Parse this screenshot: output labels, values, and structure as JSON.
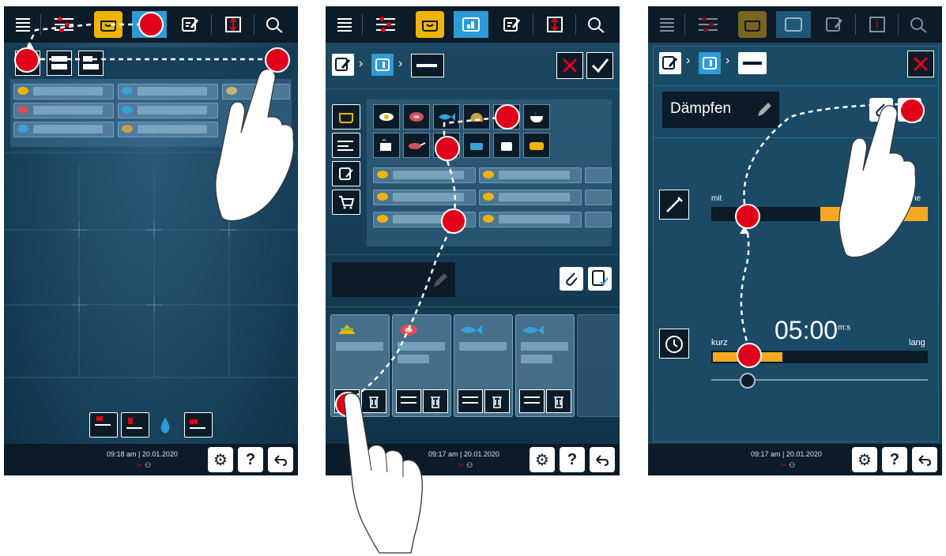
{
  "panels": [
    {
      "id": "p1",
      "time": "09:18 am",
      "date": "20.01.2020"
    },
    {
      "id": "p2",
      "time": "09:17 am",
      "date": "20.01.2020"
    },
    {
      "id": "p3",
      "time": "09:17 am",
      "date": "20.01.2020"
    }
  ],
  "bottom": {
    "help": "?"
  },
  "step": {
    "name": "Dämpfen",
    "mit_label": "mit",
    "ohne_label": "ne",
    "timer": "05:00",
    "timer_unit": "m:s",
    "kurz_label": "kurz",
    "lang_label": "lang"
  },
  "colors": {
    "accent_blue": "#2e9bd6",
    "accent_yellow": "#f0b400",
    "marker_red": "#e0001a",
    "bar_orange": "#f7a823"
  }
}
